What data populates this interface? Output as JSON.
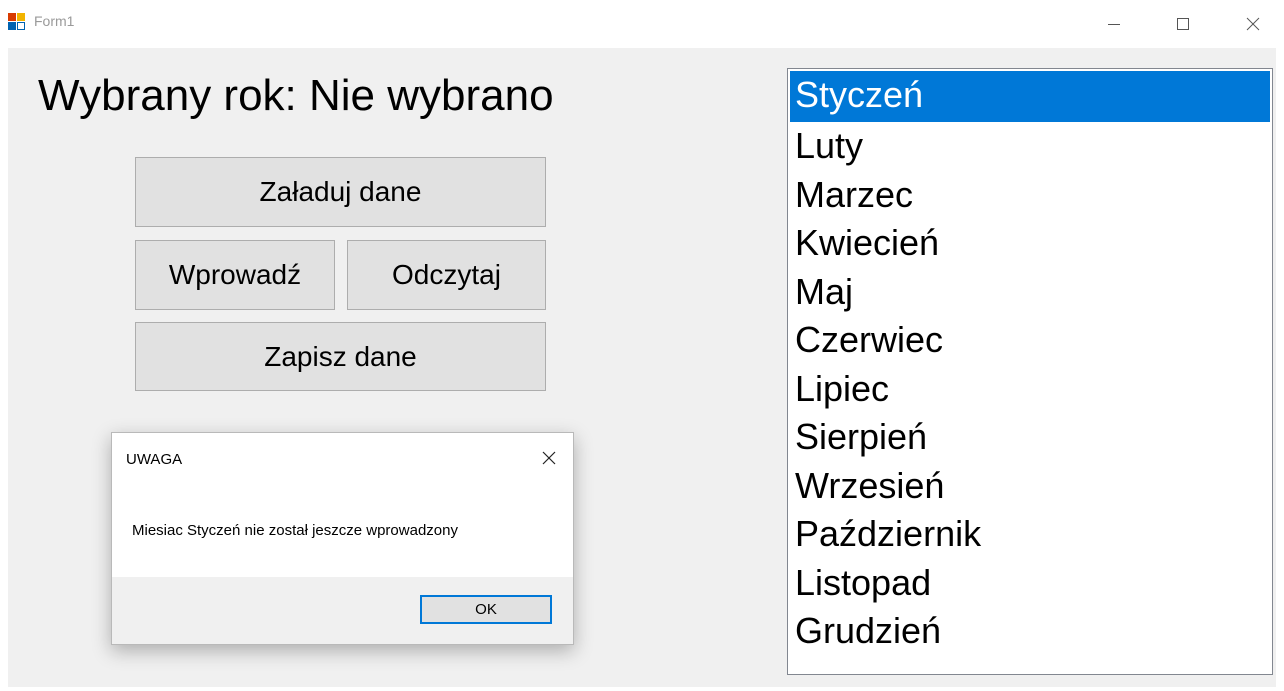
{
  "window": {
    "title": "Form1",
    "controls": {
      "minimize": "minimize-icon",
      "maximize": "maximize-icon",
      "close": "close-icon"
    }
  },
  "form": {
    "year_label": "Wybrany rok: Nie wybrano",
    "buttons": {
      "load": "Załaduj dane",
      "enter": "Wprowadź",
      "read": "Odczytaj",
      "save": "Zapisz dane"
    },
    "months": [
      "Styczeń",
      "Luty",
      "Marzec",
      "Kwiecień",
      "Maj",
      "Czerwiec",
      "Lipiec",
      "Sierpień",
      "Wrzesień",
      "Październik",
      "Listopad",
      "Grudzień"
    ],
    "selected_month_index": 0
  },
  "dialog": {
    "title": "UWAGA",
    "message": "Miesiac Styczeń nie został jeszcze wprowadzony",
    "ok_label": "OK"
  },
  "colors": {
    "selection": "#0078d7",
    "client_background": "#f0f0f0",
    "button_face": "#e1e1e1"
  }
}
